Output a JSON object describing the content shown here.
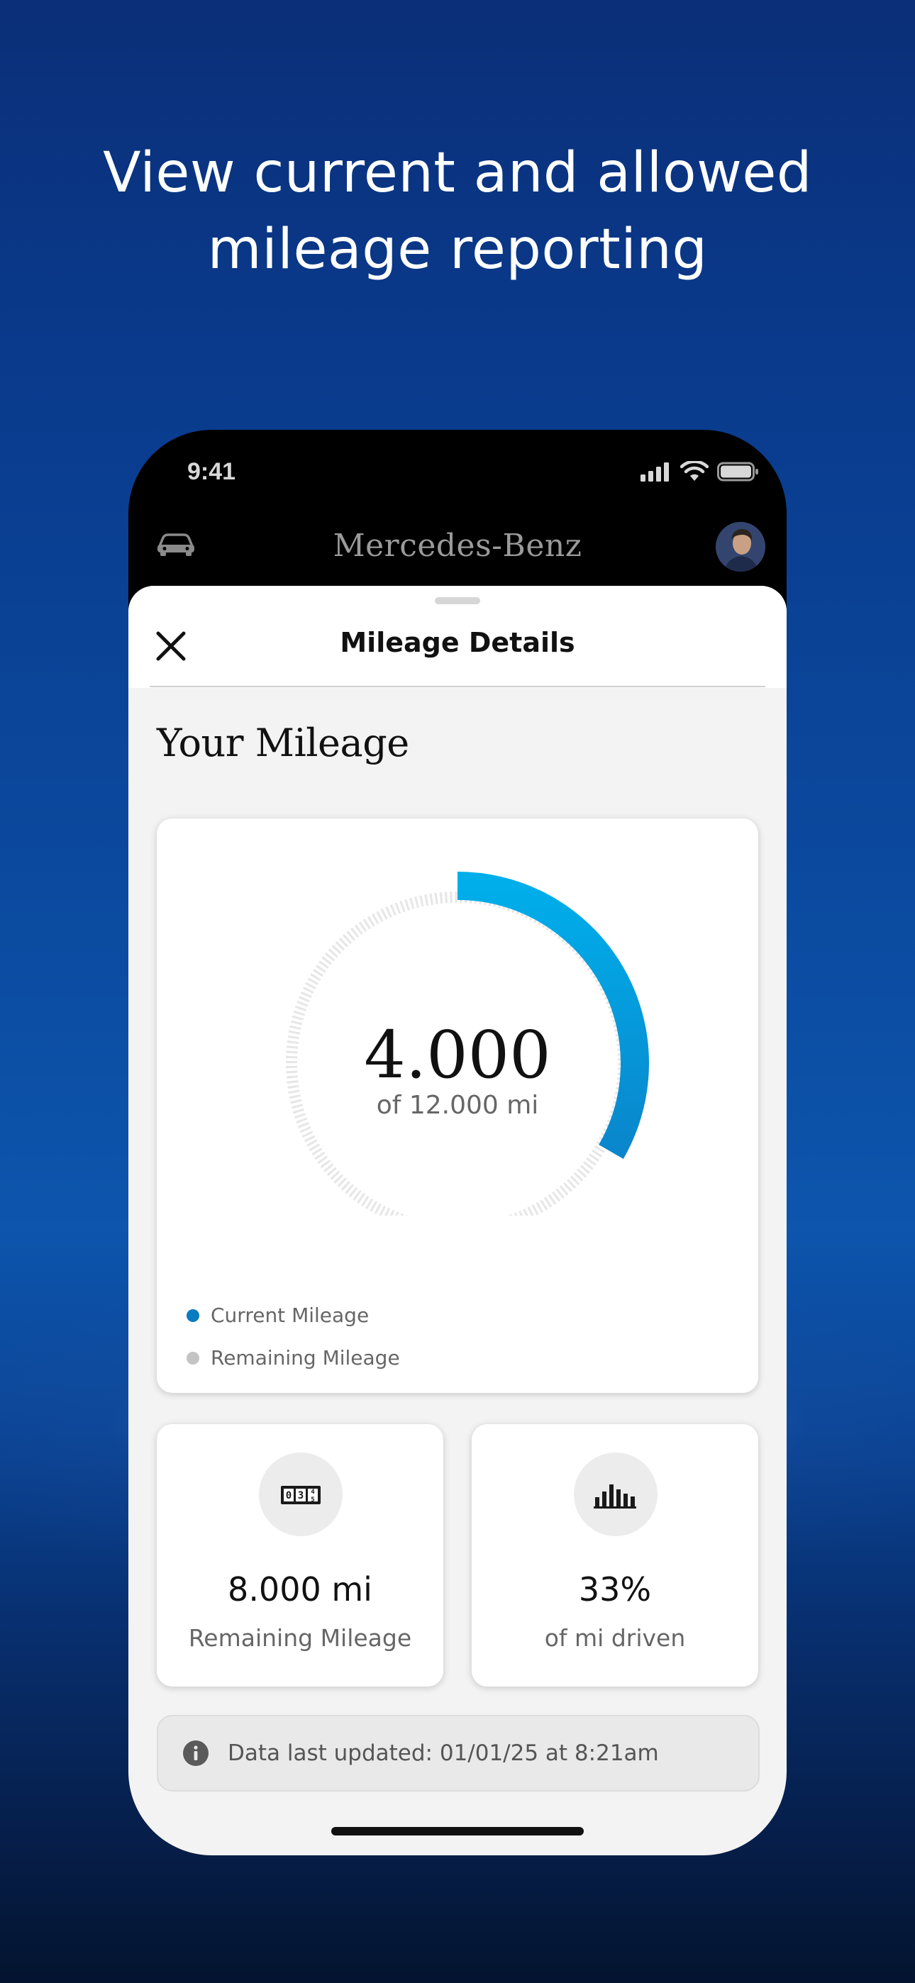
{
  "headline": {
    "line1": "View current and allowed",
    "line2": "mileage reporting"
  },
  "status_bar": {
    "time": "9:41",
    "icons": [
      "cellular-signal-icon",
      "wifi-icon",
      "battery-icon"
    ]
  },
  "app_header": {
    "brand": "Mercedes-Benz",
    "left_icon": "car-icon",
    "right_icon": "avatar"
  },
  "sheet": {
    "title": "Mileage Details",
    "close_icon": "close-icon"
  },
  "section_title": "Your Mileage",
  "gauge": {
    "value_label": "4.000",
    "total_label": "of 12.000 mi",
    "current": 4000,
    "total": 12000,
    "current_color": "#00a0e4",
    "remaining_color": "#e6e6e6"
  },
  "legend": [
    {
      "label": "Current Mileage",
      "color": "#0a7cc1"
    },
    {
      "label": "Remaining Mileage",
      "color": "#c4c4c4"
    }
  ],
  "stats": [
    {
      "icon": "odometer-icon",
      "value": "8.000 mi",
      "label": "Remaining Mileage"
    },
    {
      "icon": "bar-chart-icon",
      "value": "33%",
      "label": "of mi driven"
    }
  ],
  "info": {
    "icon": "info-icon",
    "text": "Data last updated: 01/01/25 at 8:21am"
  }
}
